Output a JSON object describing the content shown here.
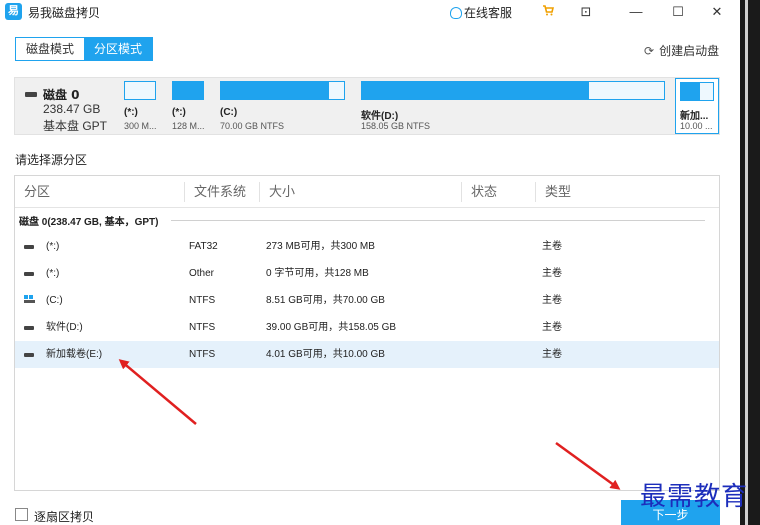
{
  "window": {
    "app_icon_glyph": "易",
    "title": "易我磁盘拷贝",
    "support_label": "在线客服",
    "icons": [
      "customer-service-icon",
      "cart-icon",
      "restore-icon",
      "minimize-icon",
      "maximize-icon",
      "close-icon"
    ],
    "buttons": {
      "restore": "⊡",
      "minimize": "—",
      "maximize": "☐",
      "close": "✕"
    }
  },
  "mode_tabs": [
    {
      "label": "磁盘模式",
      "active": false
    },
    {
      "label": "分区模式",
      "active": true
    }
  ],
  "create_boot_label": "创建启动盘",
  "disk": {
    "name": "磁盘 0",
    "size": "238.47 GB",
    "type": "基本盘 GPT",
    "partitions": [
      {
        "name": "(*:)",
        "desc": "300 M...",
        "fill": 0.0
      },
      {
        "name": "(*:)",
        "desc": "128 M...",
        "fill": 1.0
      },
      {
        "name": "(C:)",
        "desc": "70.00 GB NTFS",
        "fill": 0.88
      },
      {
        "name": "软件(D:)",
        "desc": "158.05 GB NTFS",
        "fill": 0.75
      },
      {
        "name": "新加...",
        "desc": "10.00 ...",
        "fill": 0.6,
        "selected": true
      }
    ]
  },
  "section_label": "请选择源分区",
  "table": {
    "headers": [
      "分区",
      "文件系统",
      "大小",
      "状态",
      "类型"
    ],
    "group": "磁盘 0(238.47 GB, 基本，GPT)",
    "rows": [
      {
        "name": "(*:)",
        "fs": "FAT32",
        "size": "273 MB可用，共300 MB",
        "status": "",
        "type": "主卷",
        "icon": "drive-icon"
      },
      {
        "name": "(*:)",
        "fs": "Other",
        "size": "0 字节可用，共128 MB",
        "status": "",
        "type": "主卷",
        "icon": "drive-icon"
      },
      {
        "name": "(C:)",
        "fs": "NTFS",
        "size": "8.51 GB可用，共70.00 GB",
        "status": "",
        "type": "主卷",
        "icon": "windows-drive-icon"
      },
      {
        "name": "软件(D:)",
        "fs": "NTFS",
        "size": "39.00 GB可用，共158.05 GB",
        "status": "",
        "type": "主卷",
        "icon": "drive-icon"
      },
      {
        "name": "新加载卷(E:)",
        "fs": "NTFS",
        "size": "4.01 GB可用，共10.00 GB",
        "status": "",
        "type": "主卷",
        "icon": "drive-icon",
        "selected": true
      }
    ]
  },
  "sector_copy_label": "逐扇区拷贝",
  "sector_copy_checked": false,
  "next_label": "下一步",
  "watermark": "最需教育",
  "colors": {
    "accent": "#1fa3ee",
    "arrow": "#e02020",
    "watermark": "#1c2dbb",
    "selected_row": "#e5f1fb"
  }
}
